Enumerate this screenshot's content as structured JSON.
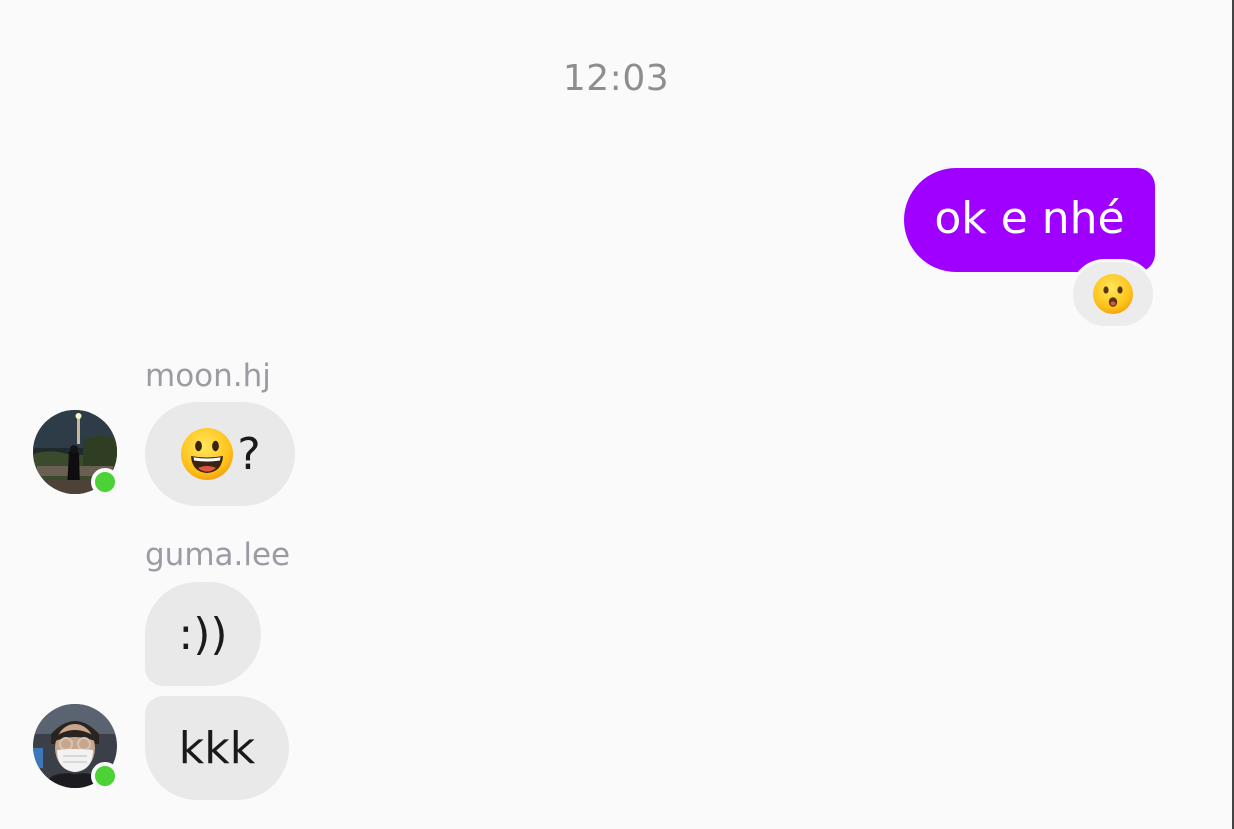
{
  "conversation": {
    "timestamp": "12:03",
    "messages": [
      {
        "direction": "outgoing",
        "text": "ok e nhé",
        "reaction": "hushed-face-emoji"
      },
      {
        "direction": "incoming",
        "sender": "moon.hj",
        "content_emoji": "grinning-face-emoji",
        "text": "?"
      },
      {
        "direction": "incoming",
        "sender": "guma.lee",
        "text": ":))"
      },
      {
        "direction": "incoming",
        "text": "kkk"
      }
    ]
  },
  "colors": {
    "outgoing_bubble": "#a000ff",
    "incoming_bubble": "#e9e9e9",
    "online_indicator": "#4cd137",
    "timestamp_text": "#8e8e8e",
    "sender_text": "#9b9ba3"
  }
}
